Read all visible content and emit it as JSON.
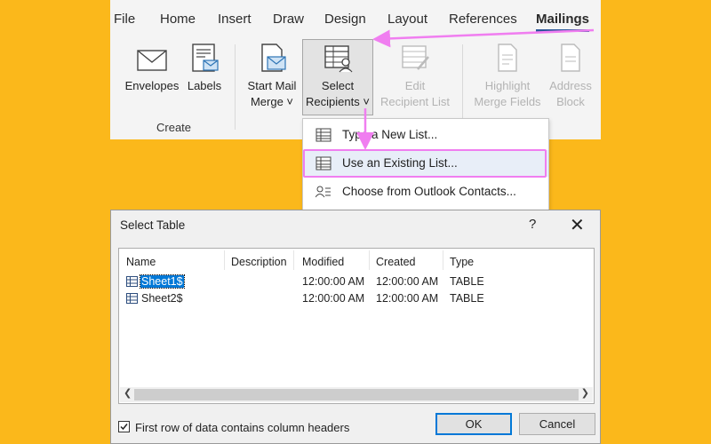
{
  "ribbon": {
    "tabs": [
      "File",
      "Home",
      "Insert",
      "Draw",
      "Design",
      "Layout",
      "References",
      "Mailings"
    ],
    "active_tab": "Mailings",
    "envelopes": "Envelopes",
    "labels": "Labels",
    "create_group": "Create",
    "start_mail_merge": [
      "Start Mail",
      "Merge ˅"
    ],
    "select_recipients": [
      "Select",
      "Recipients ˅"
    ],
    "edit_recipient_list": [
      "Edit",
      "Recipient List"
    ],
    "highlight_merge_fields": [
      "Highlight",
      "Merge Fields"
    ],
    "address_block": [
      "Address",
      "Block"
    ]
  },
  "menu": {
    "items": [
      {
        "label": "Type a New List...",
        "icon": "table-icon"
      },
      {
        "label": "Use an Existing List...",
        "icon": "table-icon"
      },
      {
        "label": "Choose from Outlook Contacts...",
        "icon": "contacts-icon"
      }
    ]
  },
  "dialog": {
    "title": "Select Table",
    "help": "?",
    "close": "✕",
    "columns": [
      "Name",
      "Description",
      "Modified",
      "Created",
      "Type"
    ],
    "rows": [
      {
        "name": "Sheet1$",
        "description": "",
        "modified": "12:00:00 AM",
        "created": "12:00:00 AM",
        "type": "TABLE"
      },
      {
        "name": "Sheet2$",
        "description": "",
        "modified": "12:00:00 AM",
        "created": "12:00:00 AM",
        "type": "TABLE"
      }
    ],
    "checkbox_label": "First row of data contains column headers",
    "checkbox_checked": true,
    "ok": "OK",
    "cancel": "Cancel"
  },
  "colors": {
    "background": "#fbb81b",
    "annotation": "#f07ef0",
    "selection": "#0078d7",
    "accent": "#2b579a"
  }
}
